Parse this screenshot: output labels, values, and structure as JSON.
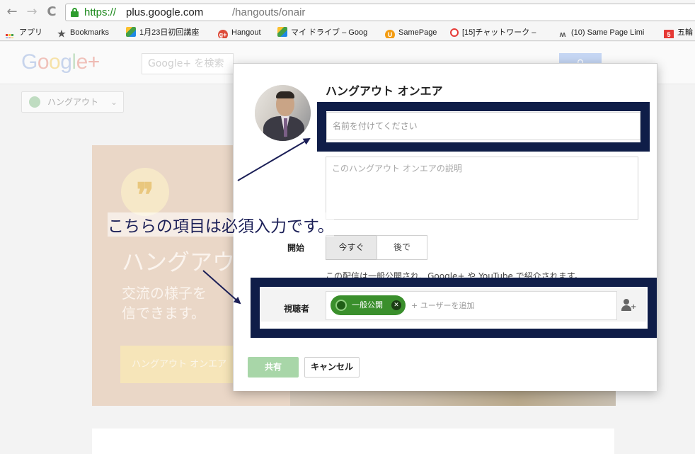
{
  "browser": {
    "back_icon": "←",
    "forward_icon": "→",
    "reload_icon": "C",
    "url_scheme": "https://",
    "url_host": "plus.google.com",
    "url_path": "/hangouts/onair",
    "bookmarks": [
      {
        "label": "アプリ",
        "icon": "apps-icon"
      },
      {
        "label": "Bookmarks",
        "icon": "star-icon"
      },
      {
        "label": "1月23日初回講座",
        "icon": "drive-icon"
      },
      {
        "label": "Hangout",
        "icon": "google-plus-icon"
      },
      {
        "label": "マイ ドライブ – Goog",
        "icon": "drive-icon"
      },
      {
        "label": "SamePage",
        "icon": "samepage-icon"
      },
      {
        "label": "[15]チャットワーク –",
        "icon": "chatwork-icon"
      },
      {
        "label": "(10) Same Page Limi",
        "icon": "samepage-limited-icon"
      },
      {
        "label": "五輪",
        "icon": "gorin-icon"
      }
    ]
  },
  "gplus": {
    "logo": {
      "g1": "G",
      "g2": "o",
      "g3": "o",
      "g4": "g",
      "g5": "l",
      "g6": "e",
      "plus": "+"
    },
    "search_placeholder": "Google+ を検索",
    "hangout_menu": "ハングアウト",
    "hero_quote": "❞",
    "hero_title": "ハングアウ",
    "hero_text_1": "交流の様子を",
    "hero_text_2": "信できます。",
    "hero_button": "ハングアウト オンエア"
  },
  "dialog": {
    "title": "ハングアウト オンエア",
    "name_placeholder": "名前を付けてください",
    "description_placeholder": "このハングアウト オンエアの説明",
    "start_label": "開始",
    "start_now": "今すぐ",
    "start_later": "後で",
    "public_note": "この配信は一般公開され、Google+ や YouTube で紹介されます。",
    "audience_label": "視聴者",
    "audience_chip": "一般公開",
    "add_user_placeholder": "+ ユーザーを追加",
    "share_button": "共有",
    "cancel_button": "キャンセル"
  },
  "annotation": {
    "text": "こちらの項目は必須入力です。",
    "color": "#1b1f57"
  },
  "colors": {
    "callout_border": "#0f1d48",
    "chip_green": "#3a8f2c",
    "share_disabled": "#a8d6a8",
    "url_green": "#1e8a1e"
  }
}
